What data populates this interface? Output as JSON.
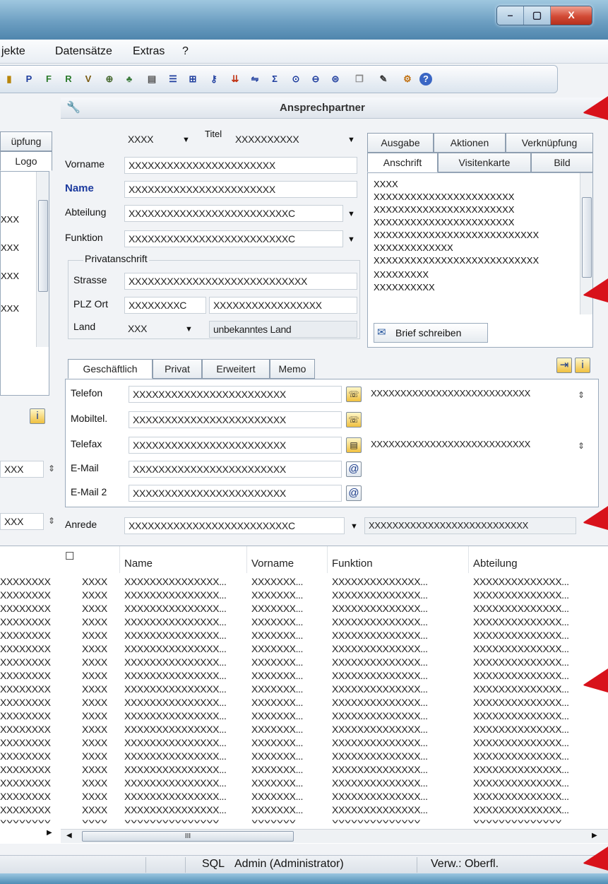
{
  "menu": [
    "jekte",
    "Datensätze",
    "Extras",
    "?"
  ],
  "window_buttons": {
    "minimize": "–",
    "maximize": "▢",
    "close": "X"
  },
  "panel_title": "Ansprechpartner",
  "left_tabs": [
    "üpfung",
    "Logo"
  ],
  "left_items": [
    "XXX",
    "XXX",
    "XXX",
    "XXX"
  ],
  "left_fields": [
    "XXX",
    "XXX"
  ],
  "form": {
    "anrede_top": "XXXX",
    "titel_label": "Titel",
    "titel": "XXXXXXXXXX",
    "vorname_label": "Vorname",
    "vorname": "XXXXXXXXXXXXXXXXXXXXXXX",
    "name_label": "Name",
    "name": "XXXXXXXXXXXXXXXXXXXXXXX",
    "abteilung_label": "Abteilung",
    "abteilung": "XXXXXXXXXXXXXXXXXXXXXXXXXC",
    "funktion_label": "Funktion",
    "funktion": "XXXXXXXXXXXXXXXXXXXXXXXXXC",
    "privat_label": "Privatanschrift",
    "strasse_label": "Strasse",
    "strasse": "XXXXXXXXXXXXXXXXXXXXXXXXXXXX",
    "plzort_label": "PLZ Ort",
    "plz": "XXXXXXXXC",
    "ort": "XXXXXXXXXXXXXXXXX",
    "land_label": "Land",
    "land": "XXX",
    "land_text": "unbekanntes Land"
  },
  "right_tabs_top": [
    "Ausgabe",
    "Aktionen",
    "Verknüpfung"
  ],
  "right_tabs_bottom": [
    "Anschrift",
    "Visitenkarte",
    "Bild"
  ],
  "address_lines": [
    "XXXX",
    "XXXXXXXXXXXXXXXXXXXXXXX",
    "XXXXXXXXXXXXXXXXXXXXXXX",
    "XXXXXXXXXXXXXXXXXXXXXXX",
    "XXXXXXXXXXXXXXXXXXXXXXXXXXX",
    "XXXXXXXXXXXXX",
    "XXXXXXXXXXXXXXXXXXXXXXXXXXX",
    "XXXXXXXXX",
    "XXXXXXXXXX"
  ],
  "brief_button": "Brief schreiben",
  "contact_tabs": [
    "Geschäftlich",
    "Privat",
    "Erweitert",
    "Memo"
  ],
  "contacts": [
    {
      "label": "Telefon",
      "value": "XXXXXXXXXXXXXXXXXXXXXXXX",
      "extra": "XXXXXXXXXXXXXXXXXXXXXXXXXXX"
    },
    {
      "label": "Mobiltel.",
      "value": "XXXXXXXXXXXXXXXXXXXXXXXX",
      "extra": ""
    },
    {
      "label": "Telefax",
      "value": "XXXXXXXXXXXXXXXXXXXXXXXX",
      "extra": "XXXXXXXXXXXXXXXXXXXXXXXXXXX"
    },
    {
      "label": "E-Mail",
      "value": "XXXXXXXXXXXXXXXXXXXXXXXX",
      "extra": ""
    },
    {
      "label": "E-Mail 2",
      "value": "XXXXXXXXXXXXXXXXXXXXXXXX",
      "extra": ""
    }
  ],
  "anrede_label": "Anrede",
  "anrede": "XXXXXXXXXXXXXXXXXXXXXXXXXC",
  "anrede_extra": "XXXXXXXXXXXXXXXXXXXXXXXXXXX",
  "left_bottom_field": "XXX",
  "grid": {
    "headers": [
      "",
      "Name",
      "Vorname",
      "Funktion",
      "Abteilung"
    ],
    "rows": [
      [
        "XXXX",
        "XXXXXXXXXXXXXXX...",
        "XXXXXXX...",
        "XXXXXXXXXXXXXX...",
        "XXXXXXXXXXXXXX..."
      ],
      [
        "XXXX",
        "XXXXXXXXXXXXXXX...",
        "XXXXXXX...",
        "XXXXXXXXXXXXXX...",
        "XXXXXXXXXXXXXX..."
      ],
      [
        "XXXX",
        "XXXXXXXXXXXXXXX...",
        "XXXXXXX...",
        "XXXXXXXXXXXXXX...",
        "XXXXXXXXXXXXXX..."
      ],
      [
        "XXXX",
        "XXXXXXXXXXXXXXX...",
        "XXXXXXX...",
        "XXXXXXXXXXXXXX...",
        "XXXXXXXXXXXXXX..."
      ],
      [
        "XXXX",
        "XXXXXXXXXXXXXXX...",
        "XXXXXXX...",
        "XXXXXXXXXXXXXX...",
        "XXXXXXXXXXXXXX..."
      ],
      [
        "XXXX",
        "XXXXXXXXXXXXXXX...",
        "XXXXXXX...",
        "XXXXXXXXXXXXXX...",
        "XXXXXXXXXXXXXX..."
      ],
      [
        "XXXX",
        "XXXXXXXXXXXXXXX...",
        "XXXXXXX...",
        "XXXXXXXXXXXXXX...",
        "XXXXXXXXXXXXXX..."
      ],
      [
        "XXXX",
        "XXXXXXXXXXXXXXX...",
        "XXXXXXX...",
        "XXXXXXXXXXXXXX...",
        "XXXXXXXXXXXXXX..."
      ],
      [
        "XXXX",
        "XXXXXXXXXXXXXXX...",
        "XXXXXXX...",
        "XXXXXXXXXXXXXX...",
        "XXXXXXXXXXXXXX..."
      ],
      [
        "XXXX",
        "XXXXXXXXXXXXXXX...",
        "XXXXXXX...",
        "XXXXXXXXXXXXXX...",
        "XXXXXXXXXXXXXX..."
      ],
      [
        "XXXX",
        "XXXXXXXXXXXXXXX...",
        "XXXXXXX...",
        "XXXXXXXXXXXXXX...",
        "XXXXXXXXXXXXXX..."
      ],
      [
        "XXXX",
        "XXXXXXXXXXXXXXX...",
        "XXXXXXX...",
        "XXXXXXXXXXXXXX...",
        "XXXXXXXXXXXXXX..."
      ],
      [
        "XXXX",
        "XXXXXXXXXXXXXXX...",
        "XXXXXXX...",
        "XXXXXXXXXXXXXX...",
        "XXXXXXXXXXXXXX..."
      ],
      [
        "XXXX",
        "XXXXXXXXXXXXXXX...",
        "XXXXXXX...",
        "XXXXXXXXXXXXXX...",
        "XXXXXXXXXXXXXX..."
      ],
      [
        "XXXX",
        "XXXXXXXXXXXXXXX...",
        "XXXXXXX...",
        "XXXXXXXXXXXXXX...",
        "XXXXXXXXXXXXXX..."
      ],
      [
        "XXXX",
        "XXXXXXXXXXXXXXX...",
        "XXXXXXX...",
        "XXXXXXXXXXXXXX...",
        "XXXXXXXXXXXXXX..."
      ],
      [
        "XXXX",
        "XXXXXXXXXXXXXXX...",
        "XXXXXXX...",
        "XXXXXXXXXXXXXX...",
        "XXXXXXXXXXXXXX..."
      ],
      [
        "XXXX",
        "XXXXXXXXXXXXXXX...",
        "XXXXXXX...",
        "XXXXXXXXXXXXXX...",
        "XXXXXXXXXXXXXX..."
      ],
      [
        "XXXX",
        "XXXXXXXXXXXXXXX...",
        "XXXXXXX...",
        "XXXXXXXXXXXXXX...",
        "XXXXXXXXXXXXXX..."
      ]
    ],
    "left_rows": "XXXXXXXX",
    "hscroll_mark": "III"
  },
  "status": {
    "sql": "SQL",
    "user": "Admin (Administrator)",
    "mode": "Verw.: Oberfl."
  },
  "icons": {
    "wrench": "wrench-icon",
    "letter": "envelope-icon",
    "at": "at-icon",
    "phone": "phone-icon"
  },
  "accent_red": "#d8121b"
}
